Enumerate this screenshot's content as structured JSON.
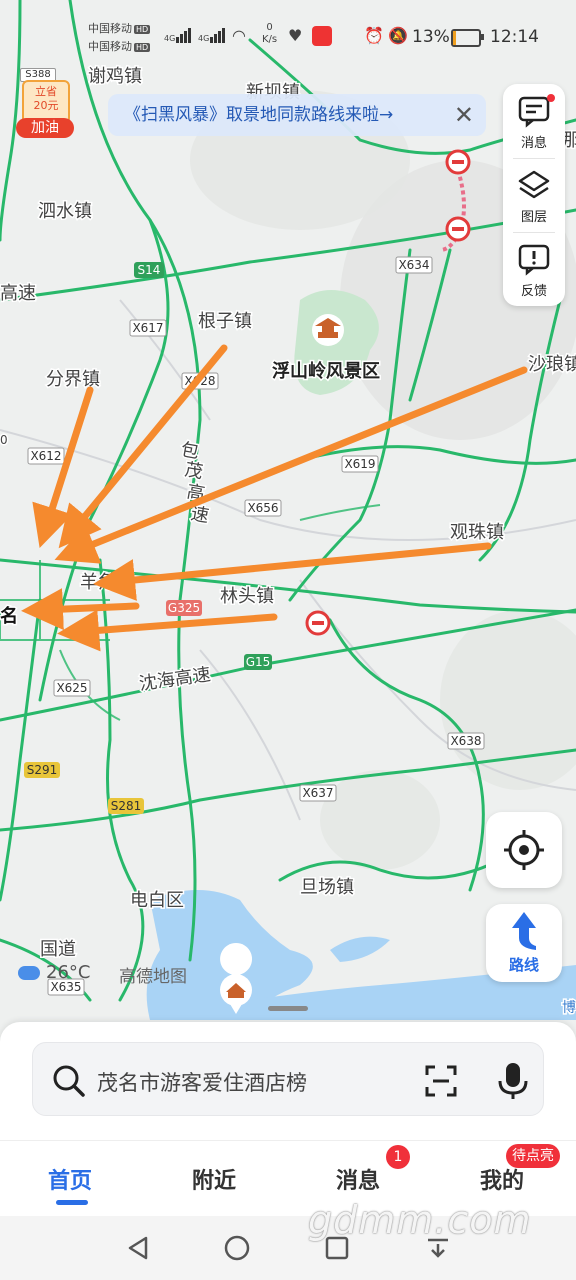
{
  "status_bar": {
    "carrier1": "中国移动",
    "carrier2": "中国移动",
    "hd": "HD",
    "net1": "4G",
    "net2": "4G",
    "speed_value": "0",
    "speed_unit": "K/s",
    "battery_pct": "13%",
    "battery_level": 0.13,
    "time": "12:14"
  },
  "banner": {
    "text": "《扫黑风暴》取景地同款路线来啦→"
  },
  "coupon": {
    "tag": "立省",
    "amount": "20元",
    "label": "加油",
    "route": "S388"
  },
  "tools": [
    {
      "label": "消息",
      "icon": "message-icon"
    },
    {
      "label": "图层",
      "icon": "layers-icon"
    },
    {
      "label": "反馈",
      "icon": "feedback-icon"
    }
  ],
  "map_labels": {
    "towns": [
      "谢鸡镇",
      "泗水镇",
      "根子镇",
      "分界镇",
      "羊角镇",
      "林头镇",
      "观珠镇",
      "沙琅镇",
      "旦场镇",
      "电白区",
      "新坝镇"
    ],
    "scenic": "浮山岭风景区",
    "highways": [
      "高速",
      "包茂高速",
      "沈海高速",
      "国道"
    ],
    "roads": [
      "S14",
      "X617",
      "X628",
      "X612",
      "X634",
      "X619",
      "X656",
      "G325",
      "G15",
      "X625",
      "X638",
      "X637",
      "S291",
      "S281",
      "X635"
    ],
    "city": "名",
    "edge": [
      "那",
      "0",
      "王",
      "博"
    ]
  },
  "weather": {
    "temp": "26°C",
    "icon": "cloud-icon"
  },
  "map_logo": "高德地图",
  "route_button": {
    "label": "路线"
  },
  "search": {
    "placeholder": "茂名市游客爱住酒店榜"
  },
  "tabs": [
    {
      "label": "首页",
      "active": true
    },
    {
      "label": "附近",
      "active": false
    },
    {
      "label": "消息",
      "active": false,
      "badge": "1"
    },
    {
      "label": "我的",
      "active": false,
      "badge": "待点亮"
    }
  ],
  "watermark": "gdmm.com",
  "colors": {
    "road_green": "#28b86a",
    "arrow_orange": "#f58a2e",
    "accent_blue": "#2a6ee6",
    "badge_red": "#f0303a"
  }
}
